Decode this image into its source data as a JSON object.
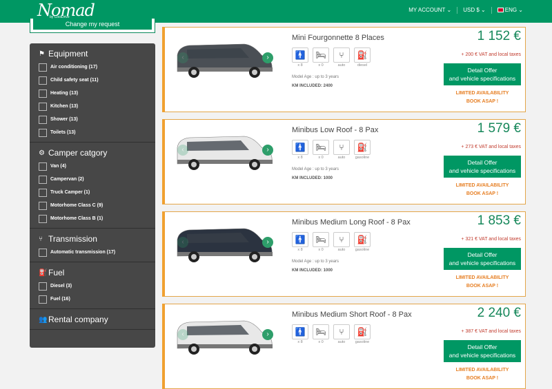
{
  "header": {
    "logo": "Nomad",
    "logo_sub": "by CoolDrive",
    "my_account": "MY ACCOUNT ⌄",
    "currency": "USD $ ⌄",
    "language": "ENG ⌄"
  },
  "sidebar": {
    "change_request": "Change my request",
    "sections": [
      {
        "title": "Equipment",
        "options": [
          "Air conditioning (17)",
          "Child safety seat (11)",
          "Heating (13)",
          "Kitchen (13)",
          "Shower (13)",
          "Toilets (13)"
        ]
      },
      {
        "title": "Camper catgory",
        "options": [
          "Van (4)",
          "Campervan (2)",
          "Truck Camper (1)",
          "Motorhome Class C (9)",
          "Motorhome Class B (1)"
        ]
      },
      {
        "title": "Transmission",
        "options": [
          "Automatic transmission (17)"
        ]
      },
      {
        "title": "Fuel",
        "options": [
          "Diesel (3)",
          "Fuel (16)"
        ]
      },
      {
        "title": "Rental company",
        "options": []
      }
    ]
  },
  "vehicles": [
    {
      "title": "Mini Fourgonnette 8 Places",
      "pax": "x 8",
      "beds": "x 0",
      "trans": "auto",
      "fuel": "diesel",
      "age": "Model Age : up to 3 years",
      "km": "KM INCLUDED: 2400",
      "price": "1 152 €",
      "tax": "+ 200 € VAT and local taxes",
      "color": "#4a4f55"
    },
    {
      "title": "Minibus Low Roof - 8 Pax",
      "pax": "x 8",
      "beds": "x 0",
      "trans": "auto",
      "fuel": "gasoline",
      "age": "Model Age : up to 3 years",
      "km": "KM INCLUDED: 1000",
      "price": "1 579 €",
      "tax": "+ 273 € VAT and local taxes",
      "color": "#e8e8e8"
    },
    {
      "title": "Minibus Medium Long Roof - 8 Pax",
      "pax": "x 8",
      "beds": "x 0",
      "trans": "auto",
      "fuel": "gasoline",
      "age": "Model Age : up to 3 years",
      "km": "KM INCLUDED: 1000",
      "price": "1 853 €",
      "tax": "+ 321 € VAT and local taxes",
      "color": "#2b3340"
    },
    {
      "title": "Minibus Medium Short Roof - 8 Pax",
      "pax": "x 8",
      "beds": "x 0",
      "trans": "auto",
      "fuel": "gasoline",
      "age": "",
      "km": "",
      "price": "2 240 €",
      "tax": "+ 387 € VAT and local taxes",
      "color": "#e8e8e8"
    }
  ],
  "labels": {
    "detail_line1": "Detail Offer",
    "detail_line2": "and vehicle specifications",
    "limited": "LIMITED AVAILABILITY",
    "book": "BOOK ASAP !"
  }
}
